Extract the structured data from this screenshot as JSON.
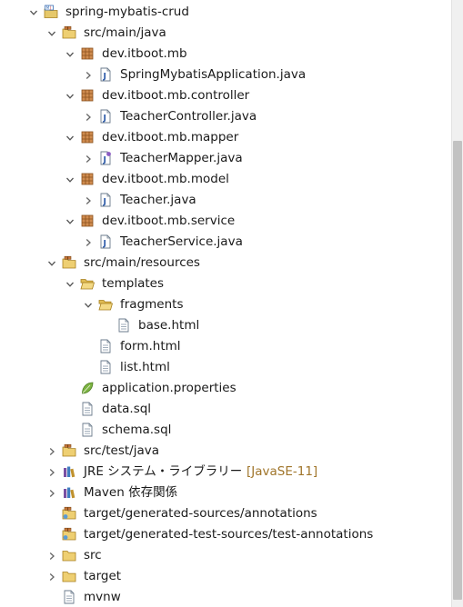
{
  "tree": {
    "items": [
      {
        "label": "spring-mybatis-crud",
        "depth": 0,
        "expand": "expanded",
        "icon": "maven-project-icon"
      },
      {
        "label": "src/main/java",
        "depth": 1,
        "expand": "expanded",
        "icon": "source-folder-icon"
      },
      {
        "label": "dev.itboot.mb",
        "depth": 2,
        "expand": "expanded",
        "icon": "package-icon"
      },
      {
        "label": "SpringMybatisApplication.java",
        "depth": 3,
        "expand": "collapsed",
        "icon": "java-file-icon"
      },
      {
        "label": "dev.itboot.mb.controller",
        "depth": 2,
        "expand": "expanded",
        "icon": "package-icon"
      },
      {
        "label": "TeacherController.java",
        "depth": 3,
        "expand": "collapsed",
        "icon": "java-file-icon"
      },
      {
        "label": "dev.itboot.mb.mapper",
        "depth": 2,
        "expand": "expanded",
        "icon": "package-icon"
      },
      {
        "label": "TeacherMapper.java",
        "depth": 3,
        "expand": "collapsed",
        "icon": "java-interface-file-icon"
      },
      {
        "label": "dev.itboot.mb.model",
        "depth": 2,
        "expand": "expanded",
        "icon": "package-icon"
      },
      {
        "label": "Teacher.java",
        "depth": 3,
        "expand": "collapsed",
        "icon": "java-file-icon"
      },
      {
        "label": "dev.itboot.mb.service",
        "depth": 2,
        "expand": "expanded",
        "icon": "package-icon"
      },
      {
        "label": "TeacherService.java",
        "depth": 3,
        "expand": "collapsed",
        "icon": "java-file-icon"
      },
      {
        "label": "src/main/resources",
        "depth": 1,
        "expand": "expanded",
        "icon": "source-folder-icon"
      },
      {
        "label": "templates",
        "depth": 2,
        "expand": "expanded",
        "icon": "open-folder-icon"
      },
      {
        "label": "fragments",
        "depth": 3,
        "expand": "expanded",
        "icon": "open-folder-icon"
      },
      {
        "label": "base.html",
        "depth": 4,
        "expand": "none",
        "icon": "text-file-icon"
      },
      {
        "label": "form.html",
        "depth": 3,
        "expand": "none",
        "icon": "text-file-icon"
      },
      {
        "label": "list.html",
        "depth": 3,
        "expand": "none",
        "icon": "text-file-icon"
      },
      {
        "label": "application.properties",
        "depth": 2,
        "expand": "none",
        "icon": "spring-leaf-icon"
      },
      {
        "label": "data.sql",
        "depth": 2,
        "expand": "none",
        "icon": "text-file-icon"
      },
      {
        "label": "schema.sql",
        "depth": 2,
        "expand": "none",
        "icon": "text-file-icon"
      },
      {
        "label": "src/test/java",
        "depth": 1,
        "expand": "collapsed",
        "icon": "source-folder-icon"
      },
      {
        "label": "JRE システム・ライブラリー",
        "decoration": "[JavaSE-11]",
        "depth": 1,
        "expand": "collapsed",
        "icon": "library-icon"
      },
      {
        "label": "Maven 依存関係",
        "depth": 1,
        "expand": "collapsed",
        "icon": "library-icon"
      },
      {
        "label": "target/generated-sources/annotations",
        "depth": 1,
        "expand": "none",
        "icon": "generated-source-folder-icon"
      },
      {
        "label": "target/generated-test-sources/test-annotations",
        "depth": 1,
        "expand": "none",
        "icon": "generated-source-folder-icon"
      },
      {
        "label": "src",
        "depth": 1,
        "expand": "collapsed",
        "icon": "folder-icon"
      },
      {
        "label": "target",
        "depth": 1,
        "expand": "collapsed",
        "icon": "folder-icon"
      },
      {
        "label": "mvnw",
        "depth": 1,
        "expand": "none",
        "icon": "text-file-icon"
      }
    ]
  }
}
